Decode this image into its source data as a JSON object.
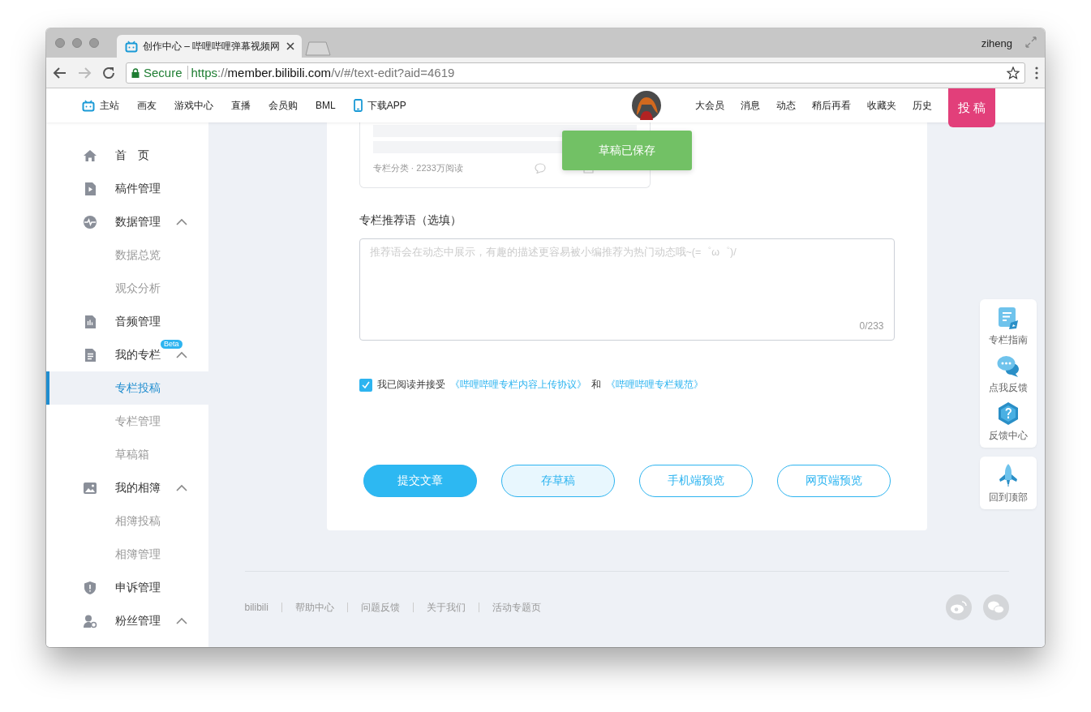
{
  "browser": {
    "tab_title": "创作中心 – 哔哩哔哩弹幕视频网",
    "profile": "ziheng",
    "secure_label": "Secure",
    "url_scheme": "https",
    "url_separator": "://",
    "url_host": "member.bilibili.com",
    "url_path": "/v/#/text-edit?aid=4619"
  },
  "site_nav": {
    "left": [
      "主站",
      "画友",
      "游戏中心",
      "直播",
      "会员购",
      "BML",
      "下载APP"
    ],
    "right": [
      "大会员",
      "消息",
      "动态",
      "稍后再看",
      "收藏夹",
      "历史"
    ],
    "upload_button": "投 稿"
  },
  "sidebar": {
    "items": [
      {
        "label": "首　页",
        "selected": false
      },
      {
        "label": "稿件管理",
        "selected": false
      },
      {
        "label": "数据管理",
        "selected": false,
        "expanded": true,
        "children": [
          {
            "label": "数据总览",
            "selected": false
          },
          {
            "label": "观众分析",
            "selected": false
          }
        ]
      },
      {
        "label": "音频管理",
        "selected": false
      },
      {
        "label": "我的专栏",
        "selected": false,
        "badge": "Beta",
        "expanded": true,
        "children": [
          {
            "label": "专栏投稿",
            "selected": true
          },
          {
            "label": "专栏管理",
            "selected": false
          },
          {
            "label": "草稿箱",
            "selected": false
          }
        ]
      },
      {
        "label": "我的相簿",
        "selected": false,
        "expanded": true,
        "children": [
          {
            "label": "相簿投稿",
            "selected": false
          },
          {
            "label": "相簿管理",
            "selected": false
          }
        ]
      },
      {
        "label": "申诉管理",
        "selected": false
      },
      {
        "label": "粉丝管理",
        "selected": false,
        "expanded": true
      }
    ]
  },
  "editor": {
    "preview": {
      "meta": "专栏分类 · 2233万阅读"
    },
    "recommend": {
      "label": "专栏推荐语（选填）",
      "placeholder": "推荐语会在动态中展示，有趣的描述更容易被小编推荐为热门动态哦~(=゜ω゜)/",
      "counter": "0/233"
    },
    "agreement": {
      "checked": true,
      "text": "我已阅读并接受",
      "link_1": "《哔哩哔哩专栏内容上传协议》",
      "conjunction": "和",
      "link_2": "《哔哩哔哩专栏规范》"
    },
    "buttons": [
      {
        "label": "提交文章",
        "kind": "primary"
      },
      {
        "label": "存草稿",
        "kind": "soft"
      },
      {
        "label": "手机端预览",
        "kind": "outline"
      },
      {
        "label": "网页端预览",
        "kind": "outline"
      }
    ]
  },
  "toast": {
    "message": "草稿已保存"
  },
  "side_tools": [
    {
      "items": [
        "专栏指南",
        "点我反馈",
        "反馈中心"
      ]
    },
    {
      "items": [
        "回到顶部"
      ]
    }
  ],
  "footer": {
    "links": [
      "bilibili",
      "帮助中心",
      "问题反馈",
      "关于我们",
      "活动专题页"
    ]
  }
}
